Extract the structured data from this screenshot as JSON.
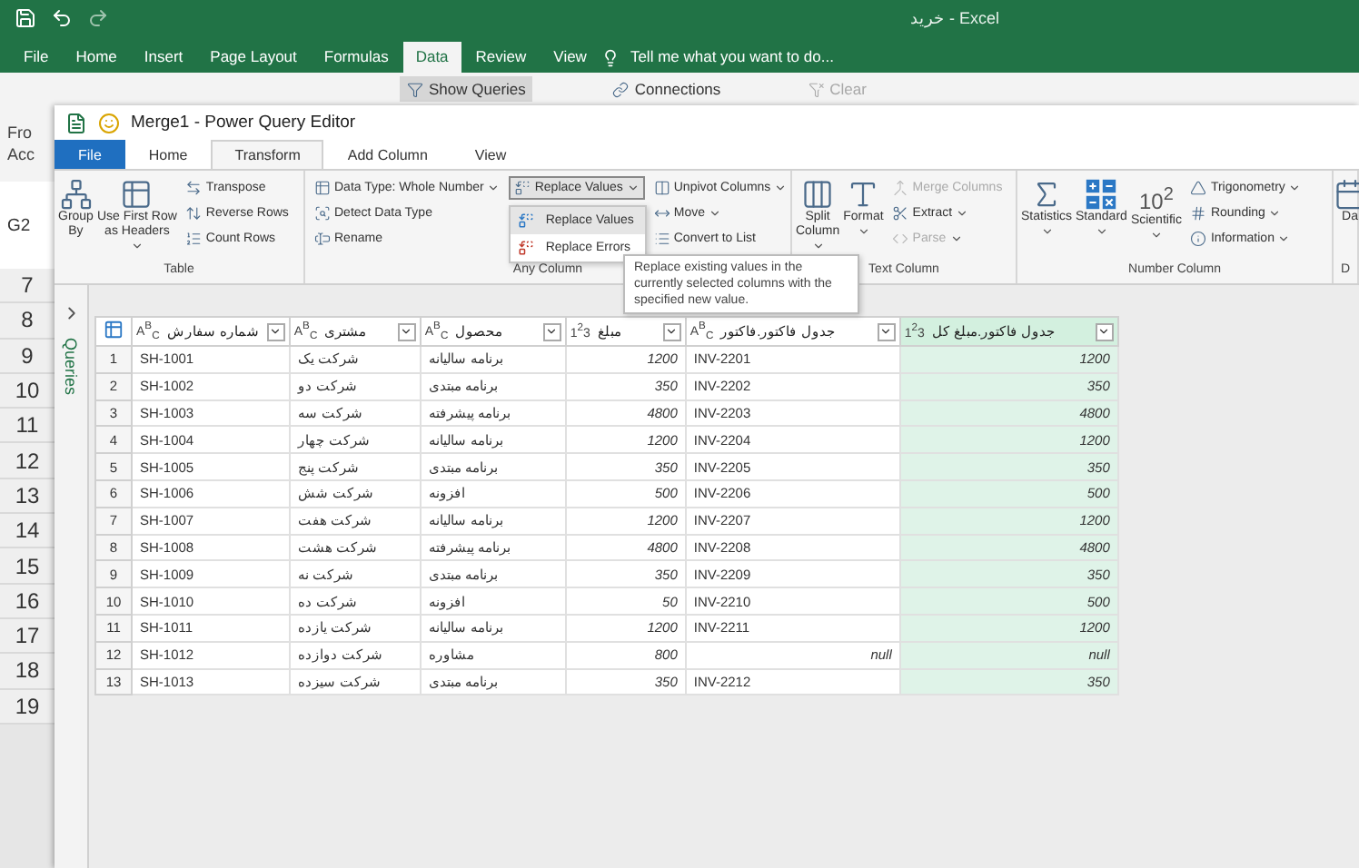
{
  "excel": {
    "title": "خرید - Excel",
    "tabs": [
      {
        "label": "File",
        "selected": false
      },
      {
        "label": "Home",
        "selected": false
      },
      {
        "label": "Insert",
        "selected": false
      },
      {
        "label": "Page Layout",
        "selected": false
      },
      {
        "label": "Formulas",
        "selected": false
      },
      {
        "label": "Data",
        "selected": true
      },
      {
        "label": "Review",
        "selected": false
      },
      {
        "label": "View",
        "selected": false
      }
    ],
    "tell_me": "Tell me what you want to do...",
    "ribbon_items": [
      {
        "label": "Show Queries",
        "selected": true,
        "disabled": false
      },
      {
        "label": "Connections",
        "selected": false,
        "disabled": false
      },
      {
        "label": "Clear",
        "selected": false,
        "disabled": true
      }
    ],
    "ribbon_fragments": [
      "Fro",
      "Acc"
    ],
    "name_box": "G2",
    "row_numbers": [
      "7",
      "8",
      "9",
      "10",
      "11",
      "12",
      "13",
      "14",
      "15",
      "16",
      "17",
      "18",
      "19"
    ]
  },
  "power_query": {
    "title": "Merge1 - Power Query Editor",
    "tabs": [
      {
        "label": "File",
        "kind": "file",
        "selected": false
      },
      {
        "label": "Home",
        "kind": "tab",
        "selected": false
      },
      {
        "label": "Transform",
        "kind": "tab",
        "selected": true
      },
      {
        "label": "Add Column",
        "kind": "tab",
        "selected": false
      },
      {
        "label": "View",
        "kind": "tab",
        "selected": false
      }
    ],
    "ribbon_groups": [
      {
        "label": "Table",
        "columns": [
          {
            "kind": "large",
            "lines": [
              "Group",
              "By"
            ],
            "dropdown": false
          },
          {
            "kind": "large",
            "lines": [
              "Use First Row",
              "as Headers"
            ],
            "dropdown": true
          },
          {
            "kind": "stack",
            "items": [
              {
                "label": "Transpose",
                "dropdown": false,
                "disabled": false,
                "open": false
              },
              {
                "label": "Reverse Rows",
                "dropdown": false,
                "disabled": false,
                "open": false
              },
              {
                "label": "Count Rows",
                "dropdown": false,
                "disabled": false,
                "open": false
              }
            ]
          }
        ]
      },
      {
        "label": "Any Column",
        "columns": [
          {
            "kind": "stack",
            "items": [
              {
                "label": "Data Type: Whole Number",
                "dropdown": true,
                "disabled": false,
                "open": false
              },
              {
                "label": "Detect Data Type",
                "dropdown": false,
                "disabled": false,
                "open": false
              },
              {
                "label": "Rename",
                "dropdown": false,
                "disabled": false,
                "open": false
              }
            ]
          },
          {
            "kind": "stack",
            "items": [
              {
                "label": "Replace Values",
                "dropdown": true,
                "disabled": false,
                "open": true
              }
            ]
          },
          {
            "kind": "stack",
            "items": [
              {
                "label": "Unpivot Columns",
                "dropdown": true,
                "disabled": false,
                "open": false
              },
              {
                "label": "Move",
                "dropdown": true,
                "disabled": false,
                "open": false
              },
              {
                "label": "Convert to List",
                "dropdown": false,
                "disabled": false,
                "open": false
              }
            ]
          }
        ]
      },
      {
        "label": "Text Column",
        "columns": [
          {
            "kind": "large",
            "lines": [
              "Split",
              "Column"
            ],
            "dropdown": true
          },
          {
            "kind": "large",
            "lines": [
              "Format"
            ],
            "dropdown": true
          },
          {
            "kind": "stack",
            "items": [
              {
                "label": "Merge Columns",
                "dropdown": false,
                "disabled": true,
                "open": false
              },
              {
                "label": "Extract",
                "dropdown": true,
                "disabled": false,
                "open": false
              },
              {
                "label": "Parse",
                "dropdown": true,
                "disabled": true,
                "open": false
              }
            ]
          }
        ]
      },
      {
        "label": "Number Column",
        "columns": [
          {
            "kind": "large",
            "lines": [
              "Statistics"
            ],
            "dropdown": true
          },
          {
            "kind": "large",
            "lines": [
              "Standard"
            ],
            "dropdown": true
          },
          {
            "kind": "large",
            "lines": [
              "Scientific"
            ],
            "dropdown": true,
            "icon_text": "10$^{2}$"
          },
          {
            "kind": "stack",
            "items": [
              {
                "label": "Trigonometry",
                "dropdown": true,
                "disabled": false,
                "open": false
              },
              {
                "label": "Rounding",
                "dropdown": true,
                "disabled": false,
                "open": false
              },
              {
                "label": "Information",
                "dropdown": true,
                "disabled": false,
                "open": false
              }
            ]
          }
        ]
      },
      {
        "label": "D",
        "columns": [
          {
            "kind": "large",
            "lines": [
              "Da"
            ],
            "dropdown": false
          }
        ]
      }
    ],
    "menu": {
      "items": [
        {
          "label": "Replace Values",
          "selected": true
        },
        {
          "label": "Replace Errors",
          "selected": false
        }
      ]
    },
    "tooltip": "Replace existing values in the currently selected columns with the specified new value.",
    "queries_pane": {
      "label": "Queries",
      "expanded": false
    },
    "table": {
      "columns": [
        {
          "name": "شماره سفارش",
          "type_label": "A$^{B}$$_{C}$",
          "kind": "text",
          "selected": false
        },
        {
          "name": "مشتری",
          "type_label": "A$^{B}$$_{C}$",
          "kind": "text",
          "selected": false
        },
        {
          "name": "محصول",
          "type_label": "A$^{B}$$_{C}$",
          "kind": "text",
          "selected": false
        },
        {
          "name": "مبلغ",
          "type_label": "1$^{2}$3",
          "kind": "number",
          "selected": false
        },
        {
          "name": "جدول فاکتور.فاکتور",
          "type_label": "A$^{B}$$_{C}$",
          "kind": "text",
          "selected": false
        },
        {
          "name": "جدول فاکتور.مبلغ کل",
          "type_label": "1$^{2}$3",
          "kind": "number",
          "selected": true
        }
      ],
      "rows": [
        {
          "index": "1",
          "cells": [
            "SH-1001",
            "شرکت یک",
            "برنامه سالیانه",
            "1200",
            "INV-2201",
            "1200"
          ]
        },
        {
          "index": "2",
          "cells": [
            "SH-1002",
            "شرکت دو",
            "برنامه مبتدی",
            "350",
            "INV-2202",
            "350"
          ]
        },
        {
          "index": "3",
          "cells": [
            "SH-1003",
            "شرکت سه",
            "برنامه پیشرفته",
            "4800",
            "INV-2203",
            "4800"
          ]
        },
        {
          "index": "4",
          "cells": [
            "SH-1004",
            "شرکت چهار",
            "برنامه سالیانه",
            "1200",
            "INV-2204",
            "1200"
          ]
        },
        {
          "index": "5",
          "cells": [
            "SH-1005",
            "شرکت پنج",
            "برنامه مبتدی",
            "350",
            "INV-2205",
            "350"
          ]
        },
        {
          "index": "6",
          "cells": [
            "SH-1006",
            "شرکت شش",
            "افزونه",
            "500",
            "INV-2206",
            "500"
          ]
        },
        {
          "index": "7",
          "cells": [
            "SH-1007",
            "شرکت هفت",
            "برنامه سالیانه",
            "1200",
            "INV-2207",
            "1200"
          ]
        },
        {
          "index": "8",
          "cells": [
            "SH-1008",
            "شرکت هشت",
            "برنامه پیشرفته",
            "4800",
            "INV-2208",
            "4800"
          ]
        },
        {
          "index": "9",
          "cells": [
            "SH-1009",
            "شرکت نه",
            "برنامه مبتدی",
            "350",
            "INV-2209",
            "350"
          ]
        },
        {
          "index": "10",
          "cells": [
            "SH-1010",
            "شرکت ده",
            "افزونه",
            "50",
            "INV-2210",
            "500"
          ]
        },
        {
          "index": "11",
          "cells": [
            "SH-1011",
            "شرکت یازده",
            "برنامه سالیانه",
            "1200",
            "INV-2211",
            "1200"
          ]
        },
        {
          "index": "12",
          "cells": [
            "SH-1012",
            "شرکت دوازده",
            "مشاوره",
            "800",
            {
              "text": "null",
              "kind": "null"
            },
            {
              "text": "null",
              "kind": "null"
            }
          ]
        },
        {
          "index": "13",
          "cells": [
            "SH-1013",
            "شرکت سیزده",
            "برنامه مبتدی",
            "350",
            "INV-2212",
            "350"
          ]
        }
      ]
    }
  }
}
